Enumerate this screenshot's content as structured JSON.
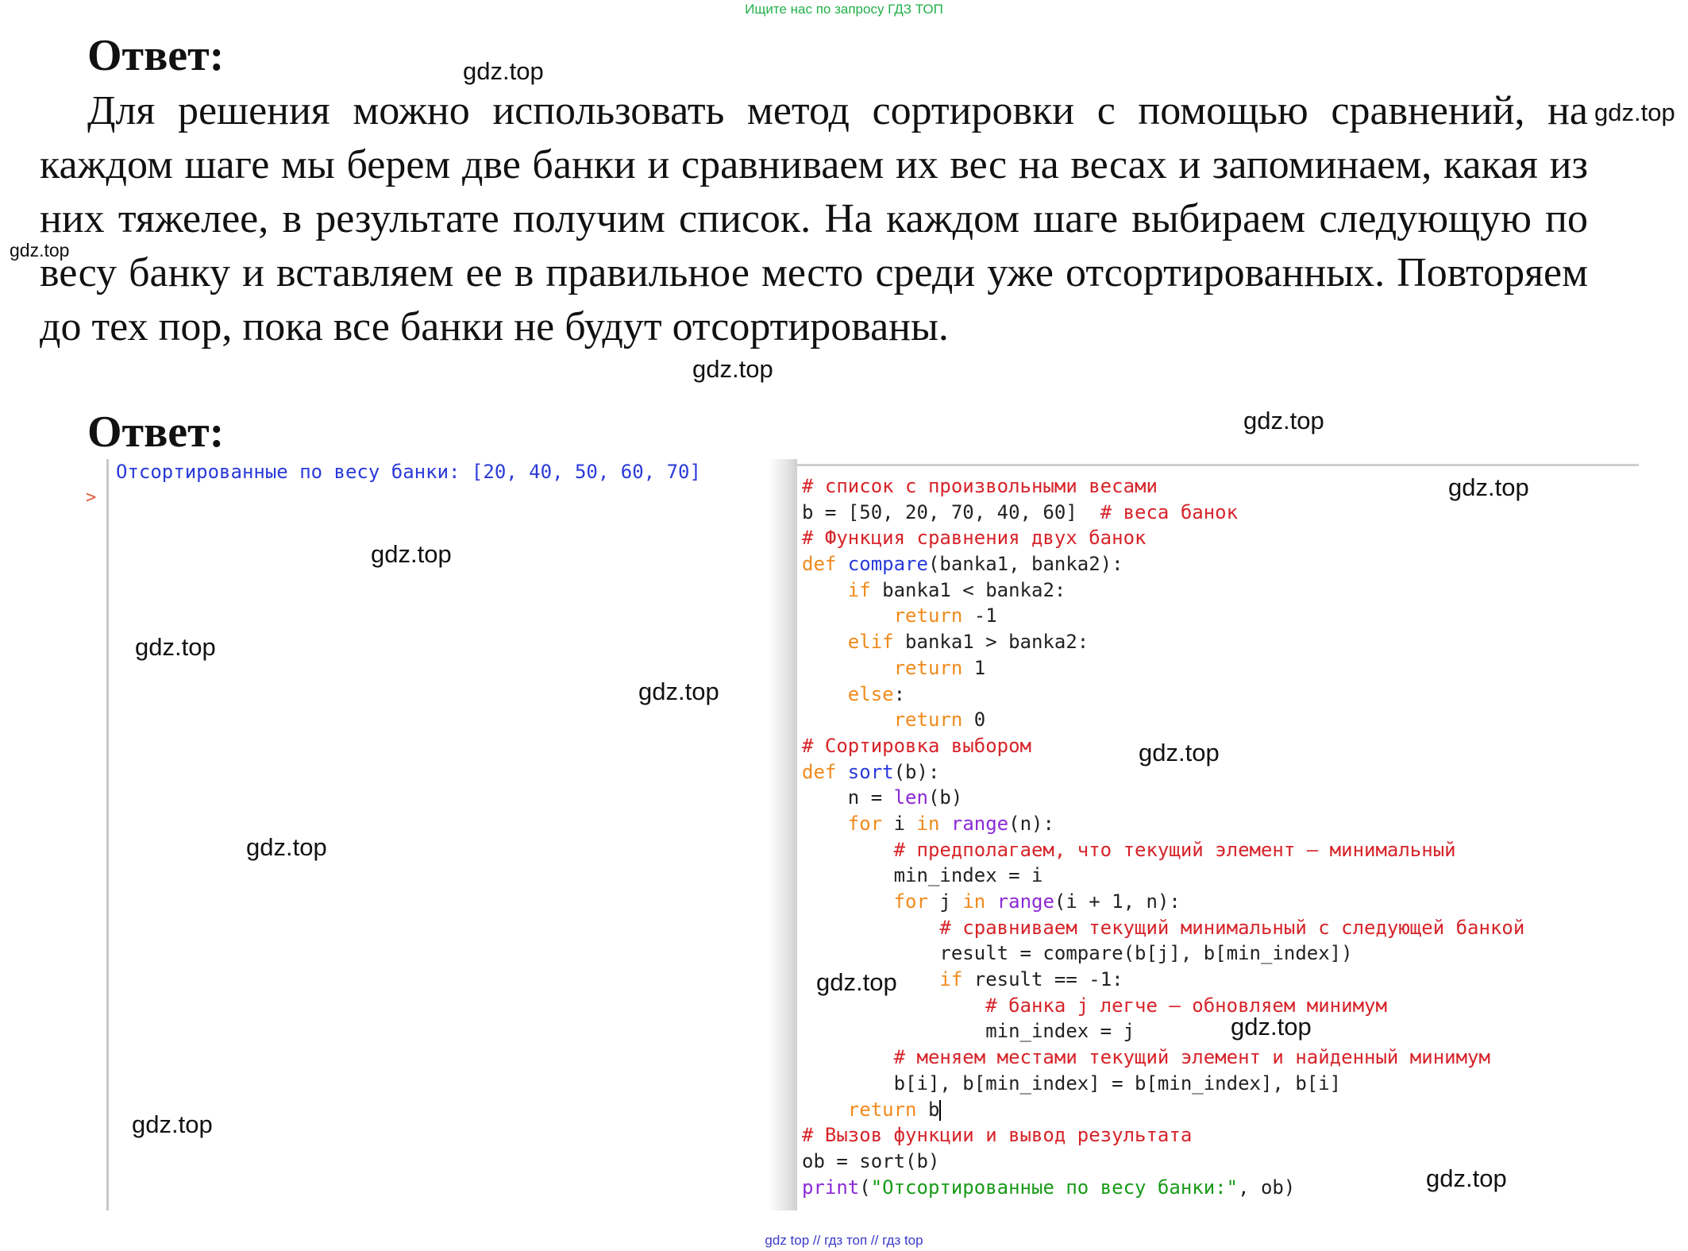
{
  "top_note": "Ищите нас по запросу ГДЗ ТОП",
  "heading1": "Ответ:",
  "paragraph": "Для решения можно использовать метод сортировки с помощью сравнений, на каждом шаге мы берем две банки и сравниваем их вес на весах и запоминаем, какая из них тяжелее, в результате получим список. На каждом шаге выбираем следующую по весу банку и вставляем ее в правильное место среди уже отсортированных. Повторяем до тех пор, пока все банки не будут отсортированы.",
  "heading2": "Ответ:",
  "shell": {
    "output": "Отсортированные по весу банки: [20, 40, 50, 60, 70]",
    "prompt": ">"
  },
  "code_lines": [
    [
      {
        "c": "c",
        "t": "# список с произвольными весами"
      }
    ],
    [
      {
        "c": "t",
        "t": "b = [50, 20, 70, 40, 60]  "
      },
      {
        "c": "c",
        "t": "# веса банок"
      }
    ],
    [
      {
        "c": "c",
        "t": "# Функция сравнения двух банок"
      }
    ],
    [
      {
        "c": "k",
        "t": "def "
      },
      {
        "c": "d",
        "t": "compare"
      },
      {
        "c": "t",
        "t": "(banka1, banka2):"
      }
    ],
    [
      {
        "c": "t",
        "t": "    "
      },
      {
        "c": "k",
        "t": "if"
      },
      {
        "c": "t",
        "t": " banka1 < banka2:"
      }
    ],
    [
      {
        "c": "t",
        "t": "        "
      },
      {
        "c": "k",
        "t": "return"
      },
      {
        "c": "t",
        "t": " -1"
      }
    ],
    [
      {
        "c": "t",
        "t": "    "
      },
      {
        "c": "k",
        "t": "elif"
      },
      {
        "c": "t",
        "t": " banka1 > banka2:"
      }
    ],
    [
      {
        "c": "t",
        "t": "        "
      },
      {
        "c": "k",
        "t": "return"
      },
      {
        "c": "t",
        "t": " 1"
      }
    ],
    [
      {
        "c": "t",
        "t": "    "
      },
      {
        "c": "k",
        "t": "else"
      },
      {
        "c": "t",
        "t": ":"
      }
    ],
    [
      {
        "c": "t",
        "t": "        "
      },
      {
        "c": "k",
        "t": "return"
      },
      {
        "c": "t",
        "t": " 0"
      }
    ],
    [
      {
        "c": "c",
        "t": "# Сортировка выбором"
      }
    ],
    [
      {
        "c": "k",
        "t": "def "
      },
      {
        "c": "d",
        "t": "sort"
      },
      {
        "c": "t",
        "t": "(b):"
      }
    ],
    [
      {
        "c": "t",
        "t": "    n = "
      },
      {
        "c": "f",
        "t": "len"
      },
      {
        "c": "t",
        "t": "(b)"
      }
    ],
    [
      {
        "c": "t",
        "t": "    "
      },
      {
        "c": "k",
        "t": "for"
      },
      {
        "c": "t",
        "t": " i "
      },
      {
        "c": "k",
        "t": "in"
      },
      {
        "c": "t",
        "t": " "
      },
      {
        "c": "f",
        "t": "range"
      },
      {
        "c": "t",
        "t": "(n):"
      }
    ],
    [
      {
        "c": "t",
        "t": "        "
      },
      {
        "c": "c",
        "t": "# предполагаем, что текущий элемент – минимальный"
      }
    ],
    [
      {
        "c": "t",
        "t": "        min_index = i"
      }
    ],
    [
      {
        "c": "t",
        "t": "        "
      },
      {
        "c": "k",
        "t": "for"
      },
      {
        "c": "t",
        "t": " j "
      },
      {
        "c": "k",
        "t": "in"
      },
      {
        "c": "t",
        "t": " "
      },
      {
        "c": "f",
        "t": "range"
      },
      {
        "c": "t",
        "t": "(i + 1, n):"
      }
    ],
    [
      {
        "c": "t",
        "t": "            "
      },
      {
        "c": "c",
        "t": "# сравниваем текущий минимальный с следующей банкой"
      }
    ],
    [
      {
        "c": "t",
        "t": "            result = compare(b[j], b[min_index])"
      }
    ],
    [
      {
        "c": "t",
        "t": "            "
      },
      {
        "c": "k",
        "t": "if"
      },
      {
        "c": "t",
        "t": " result == -1:"
      }
    ],
    [
      {
        "c": "t",
        "t": "                "
      },
      {
        "c": "c",
        "t": "# банка j легче – обновляем минимум"
      }
    ],
    [
      {
        "c": "t",
        "t": "                min_index = j"
      }
    ],
    [
      {
        "c": "t",
        "t": "        "
      },
      {
        "c": "c",
        "t": "# меняем местами текущий элемент и найденный минимум"
      }
    ],
    [
      {
        "c": "t",
        "t": "        b[i], b[min_index] = b[min_index], b[i]"
      }
    ],
    [
      {
        "c": "t",
        "t": "    "
      },
      {
        "c": "k",
        "t": "return"
      },
      {
        "c": "t",
        "t": " b"
      },
      {
        "c": "cursor",
        "t": ""
      }
    ],
    [
      {
        "c": "c",
        "t": "# Вызов функции и вывод результата"
      }
    ],
    [
      {
        "c": "t",
        "t": "ob = sort(b)"
      }
    ],
    [
      {
        "c": "f",
        "t": "print"
      },
      {
        "c": "t",
        "t": "("
      },
      {
        "c": "s",
        "t": "\"Отсортированные по весу банки:\""
      },
      {
        "c": "t",
        "t": ", ob)"
      }
    ]
  ],
  "watermark": "gdz.top",
  "bottom_note": "gdz top  //  гдз топ  //  гдз top"
}
